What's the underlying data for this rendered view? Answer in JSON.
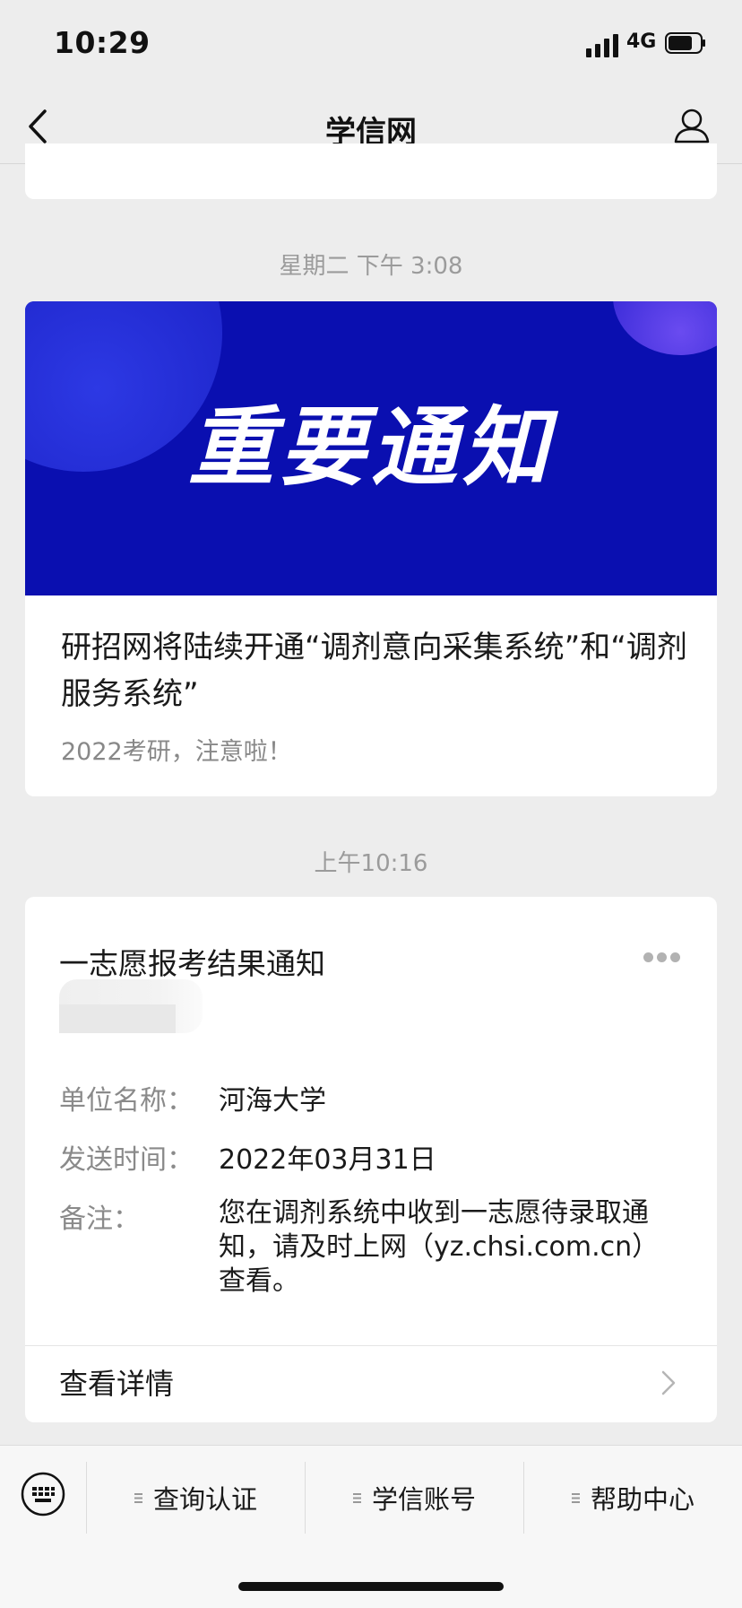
{
  "status_bar": {
    "time": "10:29",
    "network": "4G"
  },
  "nav": {
    "title": "学信网"
  },
  "messages": [
    {
      "timestamp": "星期二 下午 3:08",
      "banner_text": "重要通知",
      "title": "研招网将陆续开通“调剂意向采集系统”和“调剂服务系统”",
      "subtitle": "2022考研，注意啦！"
    },
    {
      "timestamp": "上午10:16",
      "title": "一志愿报考结果通知",
      "fields": [
        {
          "label": "单位名称：",
          "value": "河海大学"
        },
        {
          "label": "发送时间：",
          "value": "2022年03月31日"
        },
        {
          "label": "备注：",
          "value": "您在调剂系统中收到一志愿待录取通知，请及时上网（yz.chsi.com.cn）查看。"
        }
      ],
      "detail_link": "查看详情"
    }
  ],
  "bottom_menu": [
    {
      "label": "查询认证"
    },
    {
      "label": "学信账号"
    },
    {
      "label": "帮助中心"
    }
  ]
}
